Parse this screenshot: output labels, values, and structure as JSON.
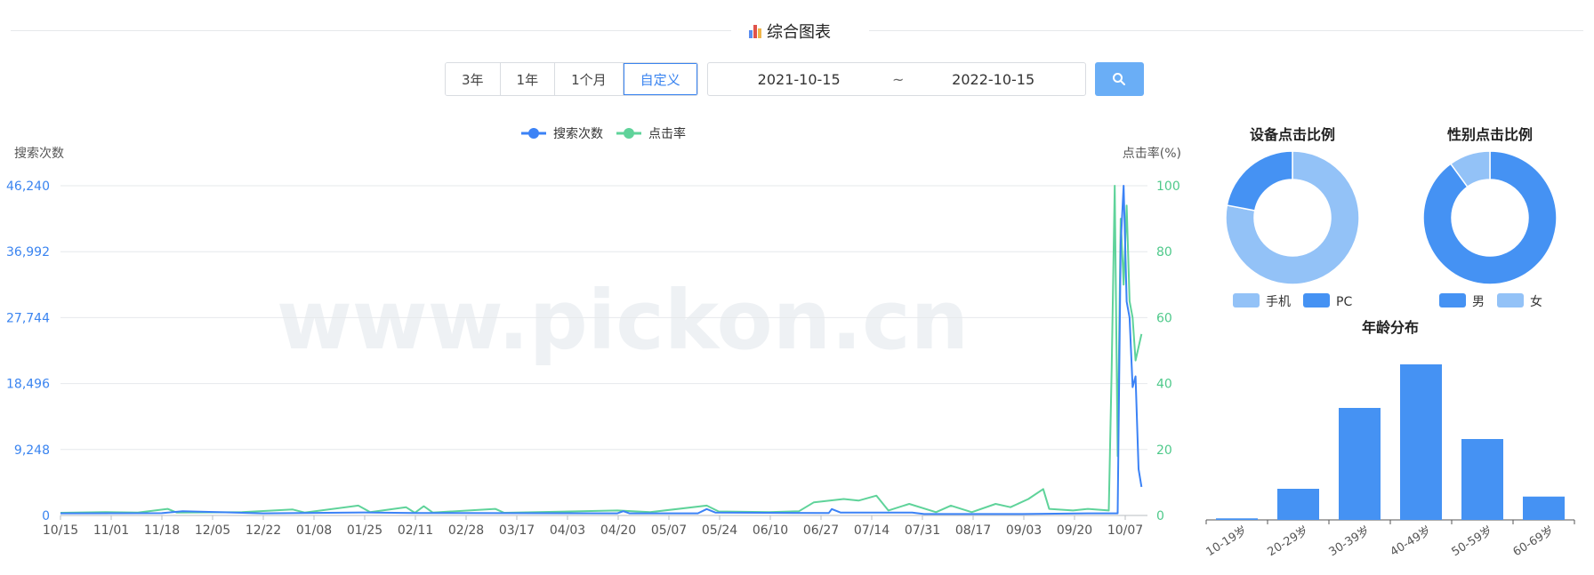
{
  "page": {
    "title": "综合图表"
  },
  "toolbar": {
    "ranges": [
      "3年",
      "1年",
      "1个月",
      "自定义"
    ],
    "active_range": "自定义",
    "start_date": "2021-10-15",
    "separator": "~",
    "end_date": "2022-10-15"
  },
  "watermark": "www.pickon.cn",
  "colors": {
    "search": "#3b82f6",
    "ctr": "#5fd39a",
    "bar": "#4592f3",
    "light": "#93c2f7"
  },
  "chart_data": [
    {
      "type": "line",
      "legend": [
        "搜索次数",
        "点击率"
      ],
      "ylabel_left": "搜索次数",
      "ylabel_right": "点击率(%)",
      "y_left_ticks": [
        "0",
        "9,248",
        "18,496",
        "27,744",
        "36,992",
        "46,240"
      ],
      "y_left_max": 46240,
      "y_right_ticks": [
        "0",
        "20",
        "40",
        "60",
        "80",
        "100"
      ],
      "y_right_max": 100,
      "x_ticks": [
        "10/15",
        "11/01",
        "11/18",
        "12/05",
        "12/22",
        "01/08",
        "01/25",
        "02/11",
        "02/28",
        "03/17",
        "04/03",
        "04/20",
        "05/07",
        "05/24",
        "06/10",
        "06/27",
        "07/14",
        "07/31",
        "08/17",
        "09/03",
        "09/20",
        "10/07"
      ],
      "x_start": "2021-10-15",
      "x_end": "2022-10-15",
      "grid": true,
      "legend_position": "top-center",
      "series": [
        {
          "name": "搜索次数",
          "points": [
            [
              "2021-10-15",
              300
            ],
            [
              "2021-11-18",
              320
            ],
            [
              "2021-11-25",
              600
            ],
            [
              "2021-12-22",
              300
            ],
            [
              "2022-01-25",
              420
            ],
            [
              "2022-02-11",
              350
            ],
            [
              "2022-04-20",
              300
            ],
            [
              "2022-04-22",
              600
            ],
            [
              "2022-04-24",
              300
            ],
            [
              "2022-05-17",
              300
            ],
            [
              "2022-05-20",
              900
            ],
            [
              "2022-05-23",
              400
            ],
            [
              "2022-06-30",
              350
            ],
            [
              "2022-07-01",
              900
            ],
            [
              "2022-07-04",
              400
            ],
            [
              "2022-07-28",
              400
            ],
            [
              "2022-08-01",
              200
            ],
            [
              "2022-09-03",
              200
            ],
            [
              "2022-09-25",
              300
            ],
            [
              "2022-10-05",
              300
            ],
            [
              "2022-10-06",
              38000
            ],
            [
              "2022-10-07",
              46240
            ],
            [
              "2022-10-08",
              30000
            ],
            [
              "2022-10-09",
              27744
            ],
            [
              "2022-10-10",
              18000
            ],
            [
              "2022-10-11",
              19500
            ],
            [
              "2022-10-12",
              6500
            ],
            [
              "2022-10-13",
              4000
            ]
          ]
        },
        {
          "name": "点击率",
          "points": [
            [
              "2021-10-15",
              0.8
            ],
            [
              "2021-10-30",
              1.0
            ],
            [
              "2021-11-10",
              0.9
            ],
            [
              "2021-11-20",
              2.0
            ],
            [
              "2021-11-23",
              0.9
            ],
            [
              "2021-12-15",
              1.0
            ],
            [
              "2022-01-01",
              1.8
            ],
            [
              "2022-01-05",
              0.9
            ],
            [
              "2022-01-23",
              3.0
            ],
            [
              "2022-01-27",
              1.0
            ],
            [
              "2022-02-08",
              2.5
            ],
            [
              "2022-02-11",
              0.8
            ],
            [
              "2022-02-14",
              2.8
            ],
            [
              "2022-02-17",
              0.9
            ],
            [
              "2022-03-10",
              2.0
            ],
            [
              "2022-03-13",
              0.8
            ],
            [
              "2022-04-20",
              1.5
            ],
            [
              "2022-05-01",
              1.0
            ],
            [
              "2022-05-20",
              3.0
            ],
            [
              "2022-05-24",
              1.2
            ],
            [
              "2022-06-10",
              1.0
            ],
            [
              "2022-06-20",
              1.3
            ],
            [
              "2022-06-25",
              4.0
            ],
            [
              "2022-07-05",
              5.0
            ],
            [
              "2022-07-10",
              4.5
            ],
            [
              "2022-07-16",
              6.0
            ],
            [
              "2022-07-20",
              1.5
            ],
            [
              "2022-07-27",
              3.5
            ],
            [
              "2022-08-05",
              1.0
            ],
            [
              "2022-08-10",
              3.0
            ],
            [
              "2022-08-17",
              1.0
            ],
            [
              "2022-08-25",
              3.5
            ],
            [
              "2022-08-30",
              2.5
            ],
            [
              "2022-09-05",
              5.0
            ],
            [
              "2022-09-10",
              8.0
            ],
            [
              "2022-09-12",
              2.0
            ],
            [
              "2022-09-20",
              1.5
            ],
            [
              "2022-09-25",
              2.0
            ],
            [
              "2022-10-02",
              1.5
            ],
            [
              "2022-10-03",
              45.0
            ],
            [
              "2022-10-04",
              100.0
            ],
            [
              "2022-10-05",
              18.0
            ],
            [
              "2022-10-06",
              90.0
            ],
            [
              "2022-10-07",
              70.0
            ],
            [
              "2022-10-08",
              94.0
            ],
            [
              "2022-10-09",
              65.0
            ],
            [
              "2022-10-10",
              60.0
            ],
            [
              "2022-10-11",
              47.0
            ],
            [
              "2022-10-13",
              55.0
            ]
          ]
        }
      ]
    },
    {
      "type": "pie",
      "title": "设备点击比例",
      "slices": [
        {
          "label": "手机",
          "value": 78
        },
        {
          "label": "PC",
          "value": 22
        }
      ],
      "legend_position": "bottom"
    },
    {
      "type": "pie",
      "title": "性别点击比例",
      "slices": [
        {
          "label": "男",
          "value": 90
        },
        {
          "label": "女",
          "value": 10
        }
      ],
      "legend_position": "bottom"
    },
    {
      "type": "bar",
      "title": "年龄分布",
      "categories": [
        "10-19岁",
        "20-29岁",
        "30-39岁",
        "40-49岁",
        "50-59岁",
        "60-69岁"
      ],
      "values": [
        0.5,
        10,
        36,
        50,
        26,
        7.5
      ],
      "ylim": [
        0,
        52
      ]
    }
  ]
}
